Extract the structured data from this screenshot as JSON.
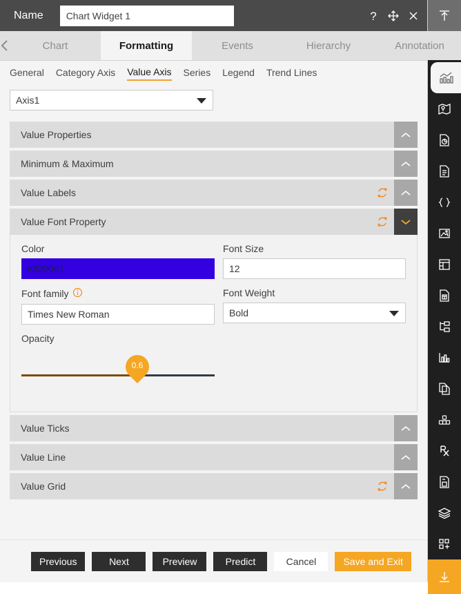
{
  "titlebar": {
    "name_label": "Name",
    "widget_name": "Chart Widget 1",
    "widget_name_placeholder": "Chart Widget 1",
    "icons": {
      "help": "help-icon",
      "move": "move-icon",
      "close": "close-icon"
    }
  },
  "tabs": {
    "prev_arrow": "chevron-left-icon",
    "next_arrow": "chevron-right-icon",
    "items": [
      {
        "label": "Chart",
        "active": false
      },
      {
        "label": "Formatting",
        "active": true
      },
      {
        "label": "Events",
        "active": false
      },
      {
        "label": "Hierarchy",
        "active": false
      },
      {
        "label": "Annotation",
        "active": false
      }
    ]
  },
  "subtabs": {
    "items": [
      {
        "label": "General",
        "active": false
      },
      {
        "label": "Category Axis",
        "active": false
      },
      {
        "label": "Value Axis",
        "active": true
      },
      {
        "label": "Series",
        "active": false
      },
      {
        "label": "Legend",
        "active": false
      },
      {
        "label": "Trend Lines",
        "active": false
      }
    ]
  },
  "axis_selector": {
    "value": "Axis1",
    "caret": "caret-down-icon"
  },
  "sections": [
    {
      "title": "Value Properties",
      "has_refresh": false,
      "expanded": false
    },
    {
      "title": "Minimum & Maximum",
      "has_refresh": false,
      "expanded": false
    },
    {
      "title": "Value Labels",
      "has_refresh": true,
      "expanded": false
    },
    {
      "title": "Value Font Property",
      "has_refresh": true,
      "expanded": true
    },
    {
      "title": "Value Ticks",
      "has_refresh": false,
      "expanded": false
    },
    {
      "title": "Value Line",
      "has_refresh": false,
      "expanded": false
    },
    {
      "title": "Value Grid",
      "has_refresh": true,
      "expanded": false
    }
  ],
  "font_property": {
    "color_label": "Color",
    "color_value": "#3300e1",
    "color_swatch_hex": "#3300e1",
    "font_size_label": "Font Size",
    "font_size_value": "12",
    "font_family_label": "Font family",
    "font_family_info_icon": "info-icon",
    "font_family_value": "Times New Roman",
    "font_weight_label": "Font Weight",
    "font_weight_value": "Bold",
    "opacity_label": "Opacity",
    "opacity_value": "0.6",
    "opacity_percent": 60
  },
  "footer": {
    "buttons": [
      {
        "label": "Previous",
        "style": "dark"
      },
      {
        "label": "Next",
        "style": "dark"
      },
      {
        "label": "Preview",
        "style": "dark"
      },
      {
        "label": "Predict",
        "style": "dark"
      },
      {
        "label": "Cancel",
        "style": "light"
      },
      {
        "label": "Save and Exit",
        "style": "accent"
      }
    ]
  },
  "rail": {
    "items": [
      {
        "name": "upload-icon",
        "state": "top"
      },
      {
        "name": "dashboard-icon",
        "state": "normal"
      },
      {
        "name": "chart-icon",
        "state": "active"
      },
      {
        "name": "map-icon",
        "state": "normal"
      },
      {
        "name": "report-pie-icon",
        "state": "normal"
      },
      {
        "name": "document-icon",
        "state": "normal"
      },
      {
        "name": "code-braces-icon",
        "state": "normal"
      },
      {
        "name": "image-icon",
        "state": "normal"
      },
      {
        "name": "table-icon",
        "state": "normal"
      },
      {
        "name": "form-document-icon",
        "state": "normal"
      },
      {
        "name": "hierarchy-icon",
        "state": "normal"
      },
      {
        "name": "bar-chart-icon",
        "state": "normal"
      },
      {
        "name": "copy-page-icon",
        "state": "normal"
      },
      {
        "name": "cubes-icon",
        "state": "normal"
      },
      {
        "name": "prescription-icon",
        "state": "normal"
      },
      {
        "name": "saved-document-icon",
        "state": "normal"
      },
      {
        "name": "layers-icon",
        "state": "normal"
      },
      {
        "name": "add-widget-icon",
        "state": "normal"
      },
      {
        "name": "download-icon",
        "state": "bottom-accent"
      }
    ]
  },
  "colors": {
    "accent": "#f5a623",
    "titlebar_bg": "#4a4a4a",
    "panel_bg": "#f4f4f4",
    "section_header_bg": "#dcdcdc",
    "rail_bg": "#1f1f1f"
  }
}
